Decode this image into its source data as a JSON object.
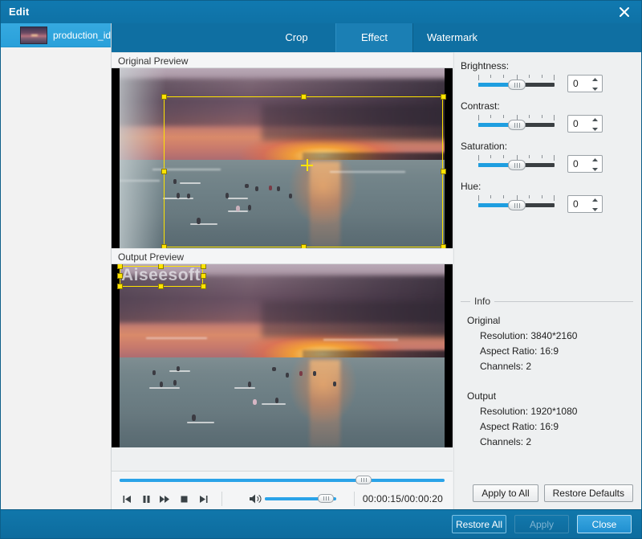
{
  "window": {
    "title": "Edit",
    "close_icon": "close-icon"
  },
  "sidebar": {
    "items": [
      {
        "label": "production_id...",
        "thumb": "video-thumbnail"
      }
    ]
  },
  "tabs": [
    {
      "label": "Crop",
      "active": false
    },
    {
      "label": "Effect",
      "active": true
    },
    {
      "label": "Watermark",
      "active": false
    }
  ],
  "previews": {
    "original": {
      "header": "Original Preview",
      "crop_overlay": true
    },
    "output": {
      "header": "Output Preview",
      "watermark_text": "Aiseesoft"
    }
  },
  "transport": {
    "progress_percent": 75,
    "volume_percent": 85,
    "time": "00:00:15/00:00:20",
    "buttons": [
      {
        "name": "previous-button",
        "icon": "skip-previous-icon"
      },
      {
        "name": "pause-button",
        "icon": "pause-icon"
      },
      {
        "name": "fast-forward-button",
        "icon": "fast-forward-icon"
      },
      {
        "name": "stop-button",
        "icon": "stop-icon"
      },
      {
        "name": "next-button",
        "icon": "skip-next-icon"
      }
    ],
    "volume_icon": "volume-icon"
  },
  "effects": {
    "controls": [
      {
        "label": "Brightness:",
        "value": "0",
        "slider_percent": 50
      },
      {
        "label": "Contrast:",
        "value": "0",
        "slider_percent": 50
      },
      {
        "label": "Saturation:",
        "value": "0",
        "slider_percent": 50
      },
      {
        "label": "Hue:",
        "value": "0",
        "slider_percent": 50
      }
    ]
  },
  "info": {
    "legend": "Info",
    "original_heading": "Original",
    "original_lines": [
      "Resolution: 3840*2160",
      "Aspect Ratio: 16:9",
      "Channels: 2"
    ],
    "output_heading": "Output",
    "output_lines": [
      "Resolution: 1920*1080",
      "Aspect Ratio: 16:9",
      "Channels: 2"
    ]
  },
  "panel_buttons": {
    "apply_to_all": "Apply to All",
    "restore_defaults": "Restore Defaults"
  },
  "footer_buttons": {
    "restore_all": "Restore All",
    "apply": "Apply",
    "close": "Close"
  },
  "colors": {
    "title_blue": "#1079b0",
    "tabstrip_blue": "#0f6fa2",
    "tab_active_blue": "#1b7fb4",
    "accent_blue": "#2aa3e8",
    "crop_yellow": "#ffe400",
    "panel_bg": "#eef0f1"
  }
}
